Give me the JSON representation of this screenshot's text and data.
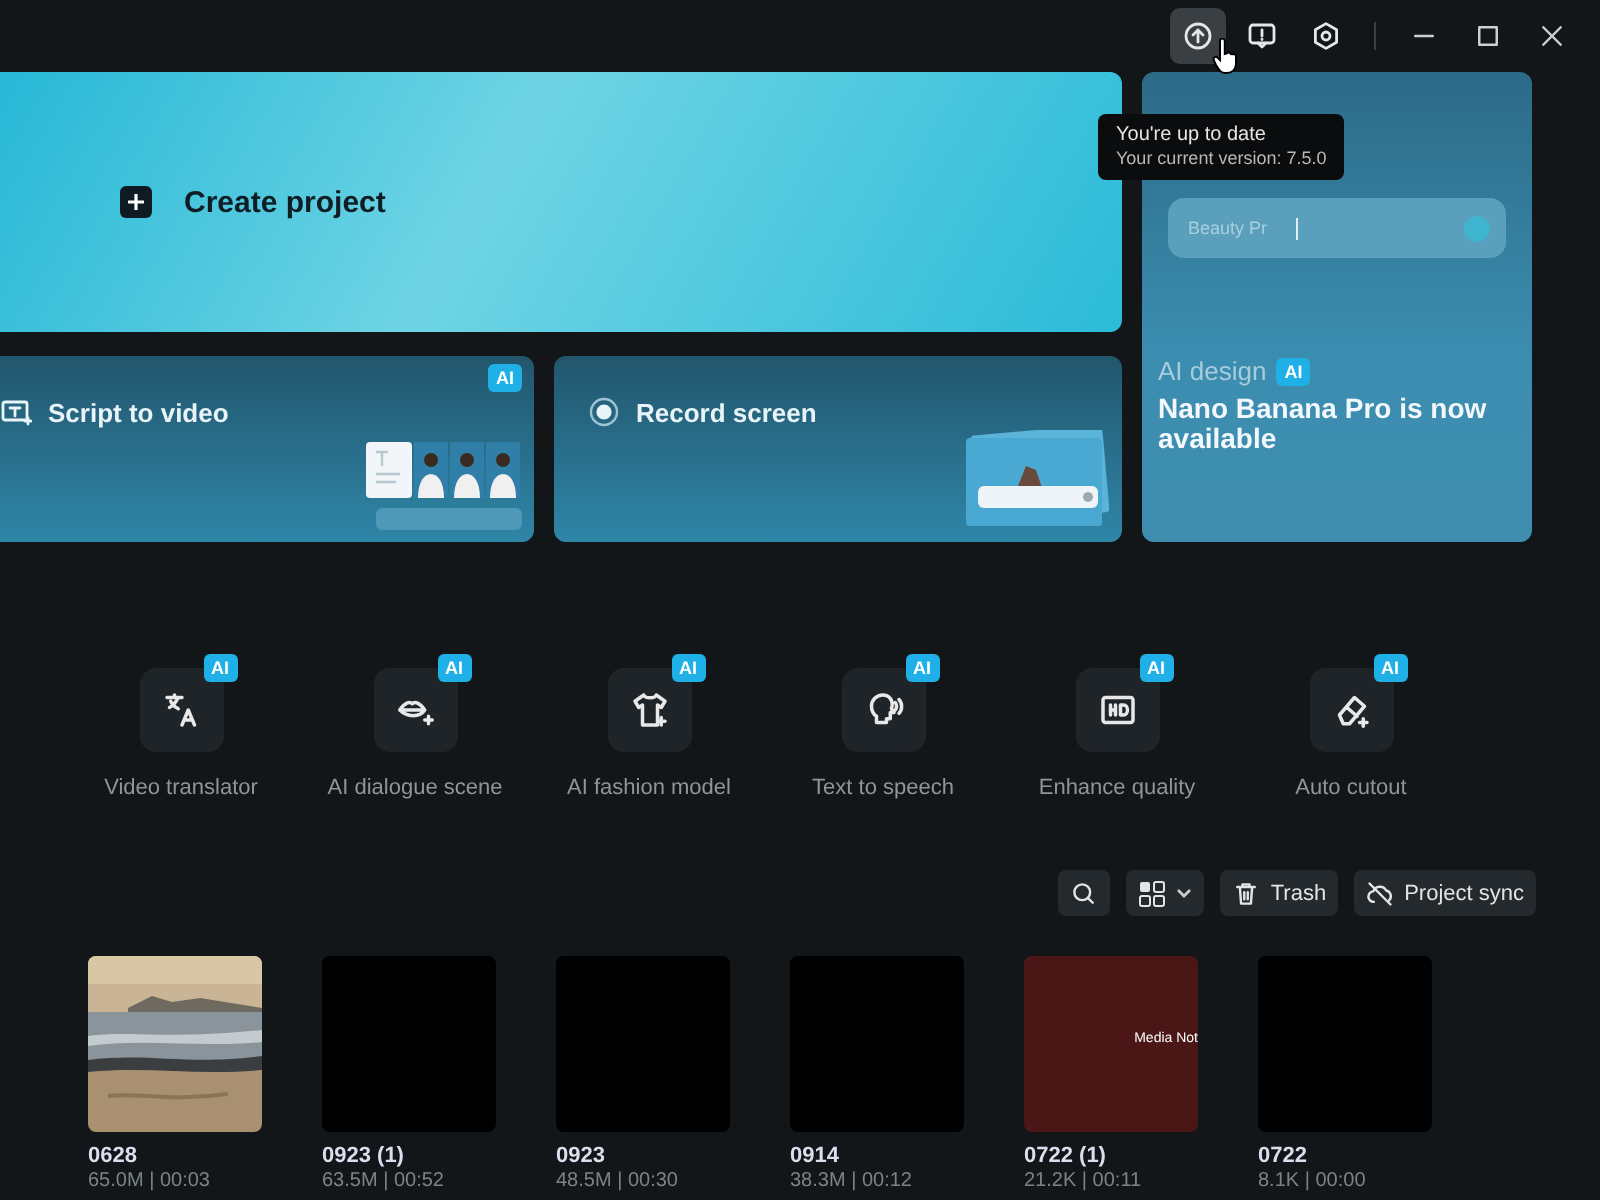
{
  "title_bar": {
    "buttons": [
      {
        "kind": "update",
        "hovered": true
      },
      {
        "kind": "feedback",
        "hovered": false
      },
      {
        "kind": "settings",
        "hovered": false
      }
    ],
    "window_controls": [
      {
        "kind": "minimize"
      },
      {
        "kind": "maximize"
      },
      {
        "kind": "close"
      }
    ]
  },
  "tooltip": {
    "title": "You're up to date",
    "text": "Your current version: 7.5.0"
  },
  "create_card": {
    "label": "Create project"
  },
  "quick_cards": [
    {
      "kind": "script",
      "label": "Script to video",
      "badge": "AI"
    },
    {
      "kind": "record",
      "label": "Record screen"
    }
  ],
  "promo_card": {
    "field_text": "Beauty Pr",
    "eyebrow": "AI design",
    "badge": "AI",
    "title": "Nano Banana Pro is now available"
  },
  "tools": [
    {
      "kind": "translate",
      "label": "Video translator",
      "badge": "AI"
    },
    {
      "kind": "dialogue",
      "label": "AI dialogue scene",
      "badge": "AI"
    },
    {
      "kind": "fashion",
      "label": "AI fashion model",
      "badge": "AI"
    },
    {
      "kind": "speech",
      "label": "Text to speech",
      "badge": "AI"
    },
    {
      "kind": "hd",
      "label": "Enhance quality",
      "badge": "AI"
    },
    {
      "kind": "cutout",
      "label": "Auto cutout",
      "badge": "AI"
    }
  ],
  "toolbar": {
    "buttons": [
      {
        "kind": "search"
      },
      {
        "kind": "view"
      },
      {
        "kind": "trash",
        "label": "Trash"
      },
      {
        "kind": "sync",
        "label": "Project sync"
      }
    ]
  },
  "projects": [
    {
      "kind": "picture",
      "name": "0628",
      "meta": "65.0M | 00:03"
    },
    {
      "kind": "black",
      "name": "0923 (1)",
      "meta": "63.5M | 00:52"
    },
    {
      "kind": "black",
      "name": "0923",
      "meta": "48.5M | 00:30"
    },
    {
      "kind": "black",
      "name": "0914",
      "meta": "38.3M | 00:12"
    },
    {
      "kind": "missing",
      "name": "0722 (1)",
      "meta": "21.2K | 00:11",
      "overlay": "Media Not"
    },
    {
      "kind": "black",
      "name": "0722",
      "meta": "8.1K | 00:00"
    }
  ]
}
